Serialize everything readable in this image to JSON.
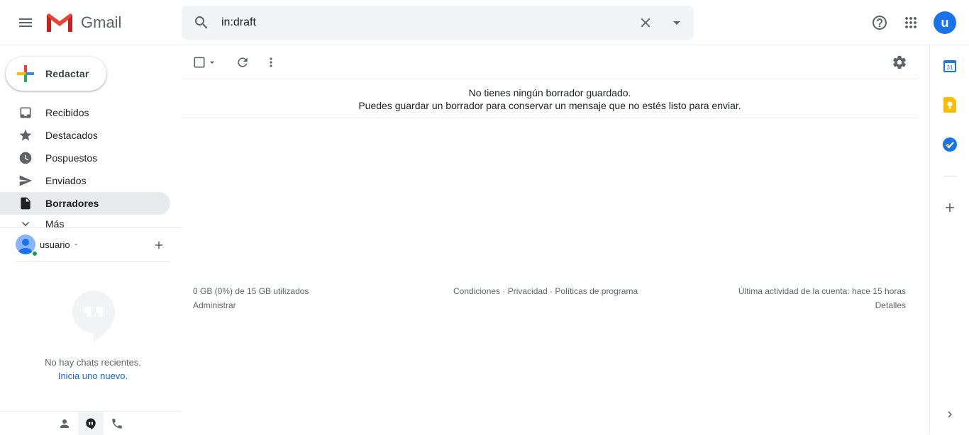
{
  "header": {
    "app_name": "Gmail",
    "search_value": "in:draft",
    "avatar_letter": "u",
    "icons": [
      "menu-icon",
      "gmail-logo",
      "search-icon",
      "clear-search-icon",
      "search-options-icon",
      "help-icon",
      "apps-icon"
    ]
  },
  "sidebar": {
    "compose_label": "Redactar",
    "items": [
      {
        "label": "Recibidos",
        "icon": "inbox-icon"
      },
      {
        "label": "Destacados",
        "icon": "star-icon"
      },
      {
        "label": "Pospuestos",
        "icon": "clock-icon"
      },
      {
        "label": "Enviados",
        "icon": "send-icon"
      },
      {
        "label": "Borradores",
        "icon": "draft-icon",
        "active": true
      },
      {
        "label": "Más",
        "icon": "chevron-down-icon"
      }
    ]
  },
  "hangouts": {
    "user_name": "usuario",
    "no_chats": "No hay chats recientes.",
    "start_new": "Inicia uno nuevo."
  },
  "main": {
    "empty_title": "No tienes ningún borrador guardado.",
    "empty_subtitle": "Puedes guardar un borrador para conservar un mensaje que no estés listo para enviar.",
    "footer": {
      "storage": "0 GB (0%) de 15 GB utilizados",
      "manage": "Administrar",
      "links": "Condiciones · Privacidad · Políticas de programa",
      "last_activity": "Última actividad de la cuenta: hace 15 horas",
      "details": "Detalles"
    }
  },
  "right_panel": {
    "calendar_day": "31"
  },
  "colors": {
    "accent": "#1a73e8",
    "active_bg": "#e8eaed",
    "link": "#1967d2"
  }
}
